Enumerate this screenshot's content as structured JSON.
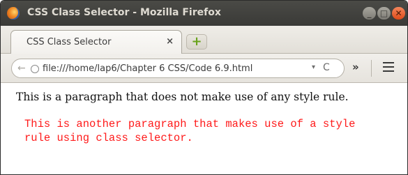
{
  "window": {
    "title": "CSS Class Selector - Mozilla Firefox",
    "min_glyph": "_",
    "max_glyph": "□",
    "close_glyph": "✕"
  },
  "tabs": [
    {
      "label": "CSS Class Selector",
      "close_glyph": "×"
    }
  ],
  "newtab_glyph": "+",
  "navbar": {
    "url": "file:///home/lap6/Chapter 6 CSS/Code 6.9.html",
    "back_glyph": "←",
    "dropmark_glyph": "▾",
    "reload_glyph": "C",
    "overflow_glyph": "»"
  },
  "page": {
    "paragraph1": "This is a paragraph that does not make use of any style rule.",
    "paragraph2": "This is another paragraph that makes use of a style rule using class selector."
  },
  "colors": {
    "styled_text": "#ff1a1a",
    "titlebar": "#3a3a37",
    "close_button": "#df4a18"
  },
  "icons": [
    "firefox-logo-icon",
    "back-arrow-icon",
    "globe-icon",
    "dropdown-icon",
    "reload-icon",
    "overflow-chevron-icon",
    "hamburger-menu-icon",
    "new-tab-icon"
  ]
}
